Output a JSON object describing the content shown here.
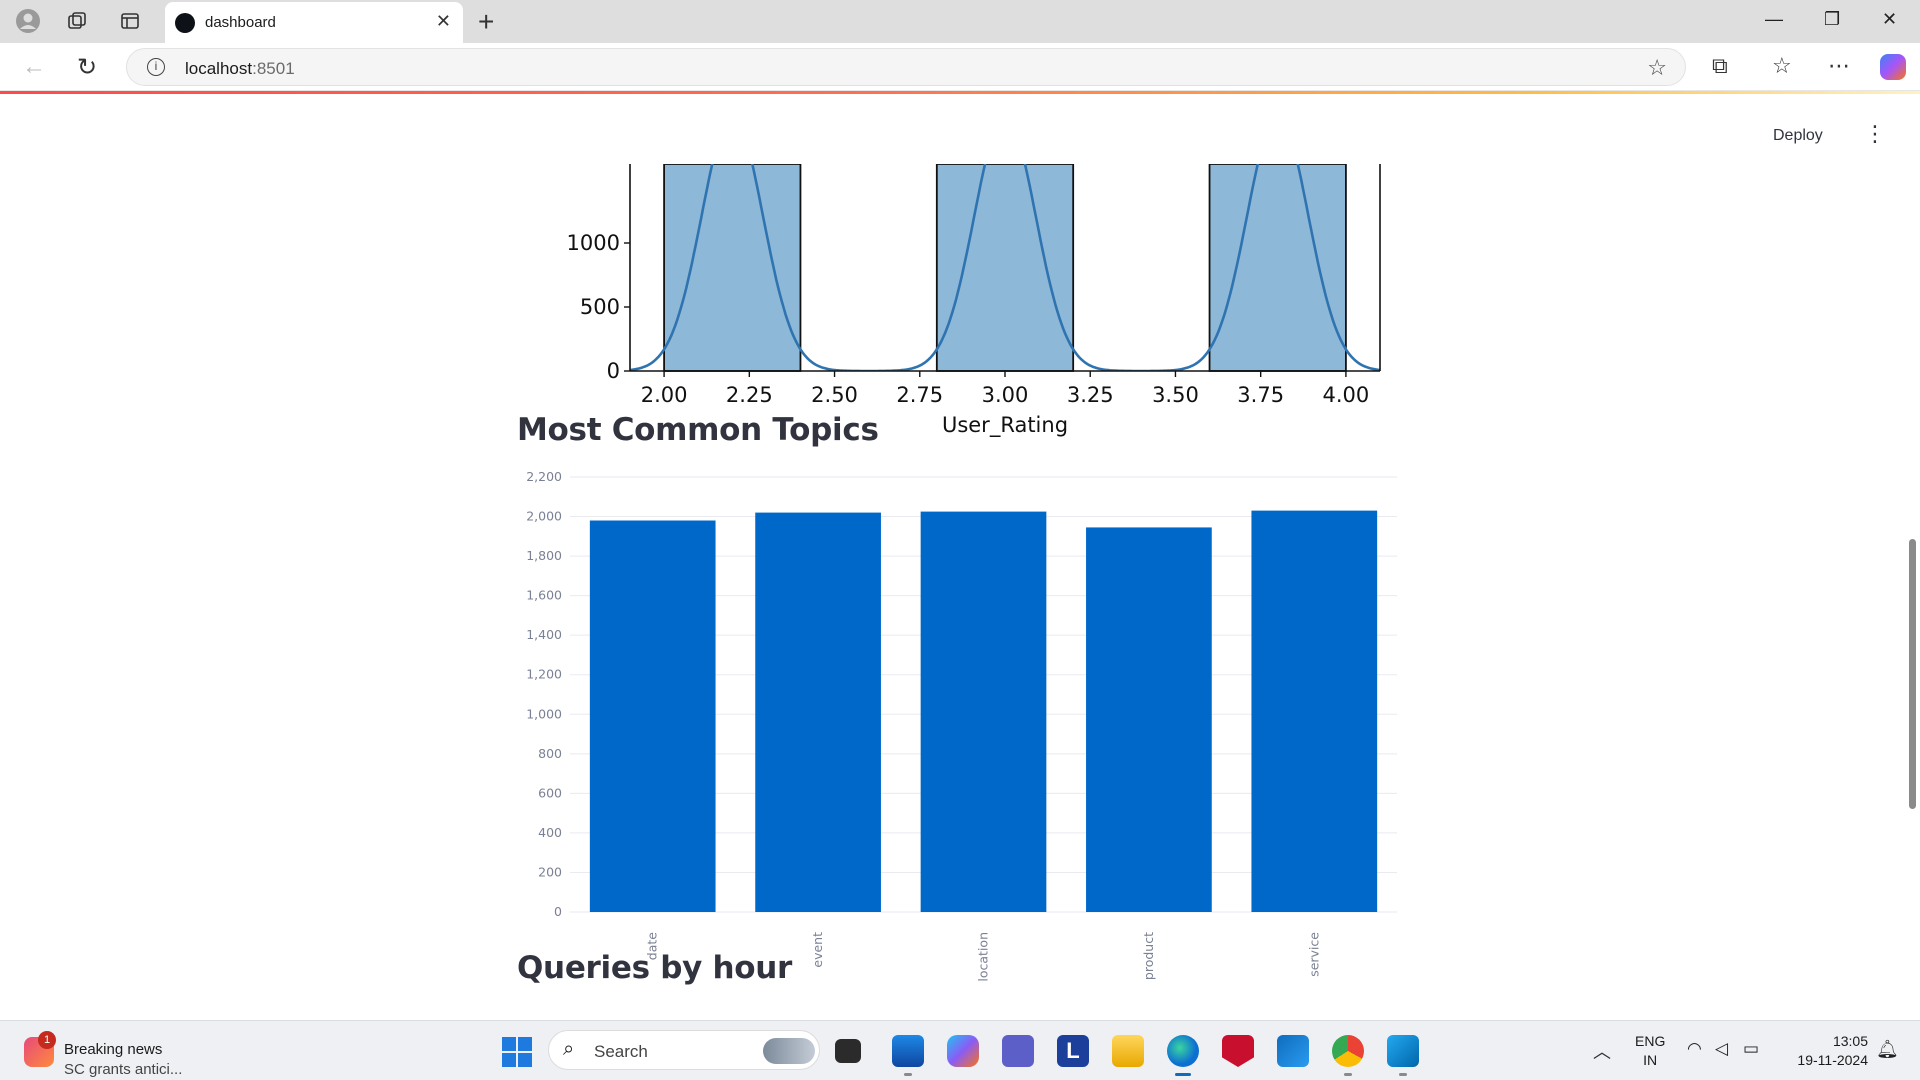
{
  "browser": {
    "tab_title": "dashboard",
    "url_host": "localhost",
    "url_port": ":8501"
  },
  "app": {
    "deploy_label": "Deploy"
  },
  "sections": {
    "topics_title": "Most Common Topics",
    "queries_title": "Queries by hour"
  },
  "chart_data": [
    {
      "type": "bar",
      "title": "",
      "xlabel": "User_Rating",
      "ylabel": "",
      "x_ticks": [
        "2.00",
        "2.25",
        "2.50",
        "2.75",
        "3.00",
        "3.25",
        "3.50",
        "3.75",
        "4.00"
      ],
      "y_ticks": [
        "0",
        "500",
        "1000"
      ],
      "xlim": [
        1.9,
        4.1
      ],
      "ylim_visible": [
        0,
        1000
      ],
      "bins": [
        {
          "x0": 2.0,
          "x1": 2.4,
          "count": 2000
        },
        {
          "x0": 2.8,
          "x1": 3.2,
          "count": 2000
        },
        {
          "x0": 3.6,
          "x1": 4.0,
          "count": 2000
        }
      ],
      "kde": true,
      "colors": {
        "bar": "#8eb8d8",
        "kde": "#2f74b0"
      }
    },
    {
      "type": "bar",
      "title": "Most Common Topics",
      "categories": [
        "date",
        "event",
        "location",
        "product",
        "service"
      ],
      "values": [
        1980,
        2020,
        2025,
        1945,
        2030
      ],
      "y_ticks": [
        "0",
        "200",
        "400",
        "600",
        "800",
        "1,000",
        "1,200",
        "1,400",
        "1,600",
        "1,800",
        "2,000",
        "2,200"
      ],
      "ylim": [
        0,
        2200
      ],
      "colors": {
        "bar": "#0068c9"
      }
    }
  ],
  "taskbar": {
    "news_title": "Breaking news",
    "news_sub": "SC grants antici...",
    "news_badge": "1",
    "search_label": "Search",
    "lang_line1": "ENG",
    "lang_line2": "IN",
    "time": "13:05",
    "date": "19-11-2024"
  }
}
